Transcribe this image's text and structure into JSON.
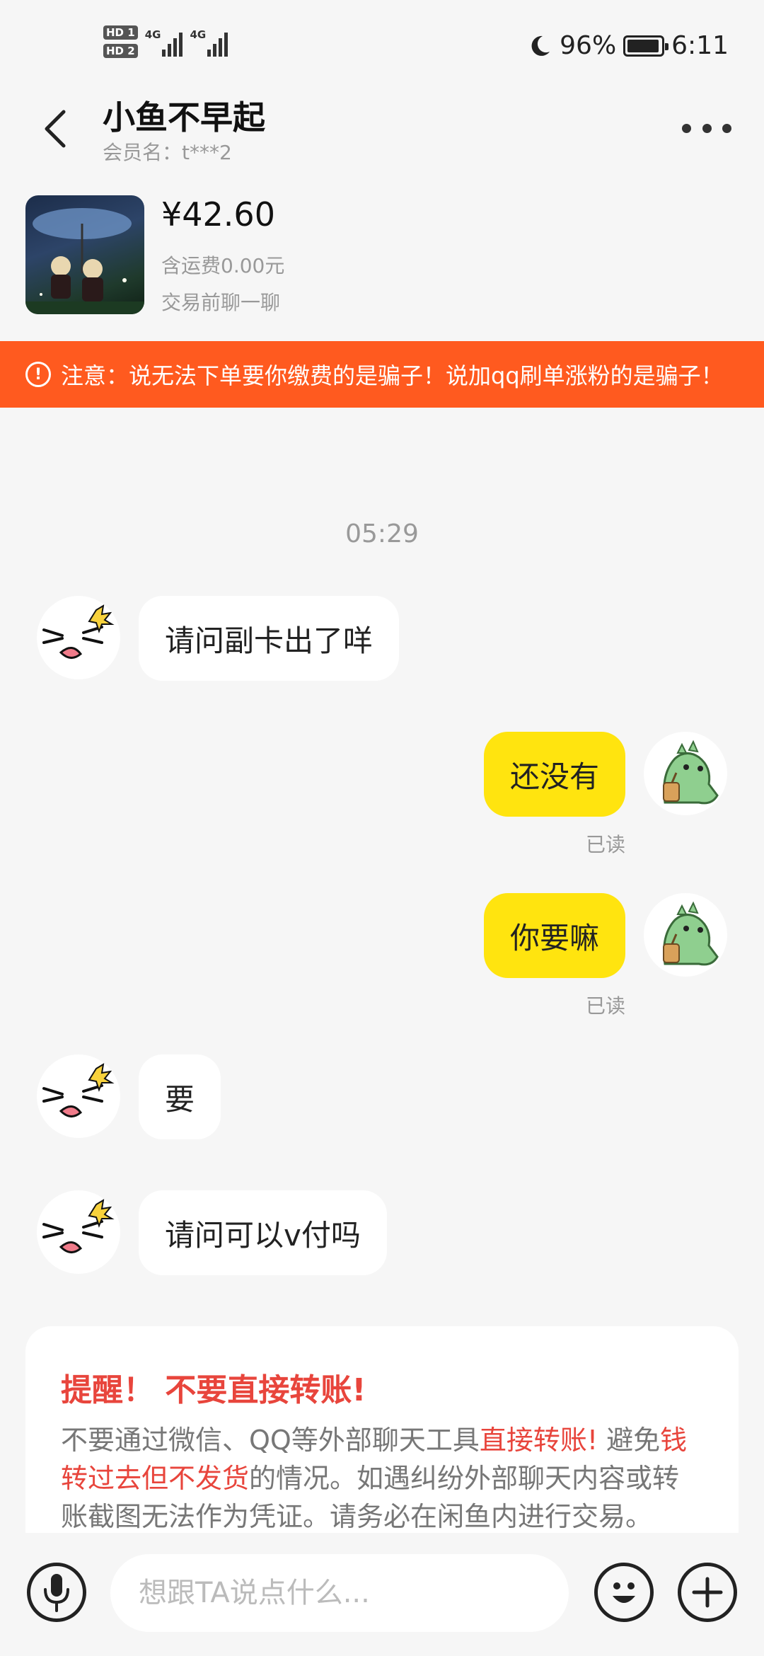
{
  "status_bar": {
    "hd1": "HD",
    "sim1": "1",
    "hd2": "HD",
    "sim2": "2",
    "net1": "4G",
    "net2": "4G",
    "battery": "96%",
    "time": "6:11",
    "battery_level": 0.96
  },
  "header": {
    "title": "小鱼不早起",
    "member": "会员名：t***2"
  },
  "product": {
    "price": "¥42.60",
    "shipping": "含运费0.00元",
    "chat_before": "交易前聊一聊"
  },
  "warning": {
    "icon": "!",
    "text": "注意：说无法下单要你缴费的是骗子！说加qq刷单涨粉的是骗子！"
  },
  "chat": {
    "timestamp": "05:29",
    "messages": [
      {
        "side": "in",
        "text": "请问副卡出了咩"
      },
      {
        "side": "out",
        "text": "还没有",
        "status": "已读"
      },
      {
        "side": "out",
        "text": "你要嘛",
        "status": "已读"
      },
      {
        "side": "in",
        "text": "要"
      },
      {
        "side": "in",
        "text": "请问可以v付吗"
      }
    ]
  },
  "reminder": {
    "title": "提醒！ 不要直接转账!",
    "body_1": "不要通过微信、QQ等外部聊天工具",
    "body_red_1": "直接转账!",
    "body_2": " 避免",
    "body_red_2": "钱转过去但不发货",
    "body_3": "的情况。如遇纠纷外部聊天内容或转账截图无法作为凭证。请务必在闲鱼内进行交易。"
  },
  "input_bar": {
    "placeholder": "想跟TA说点什么..."
  },
  "colors": {
    "accent_yellow": "#ffe40f",
    "warning_orange": "#ff5a1f",
    "reminder_red": "#e8453c"
  }
}
